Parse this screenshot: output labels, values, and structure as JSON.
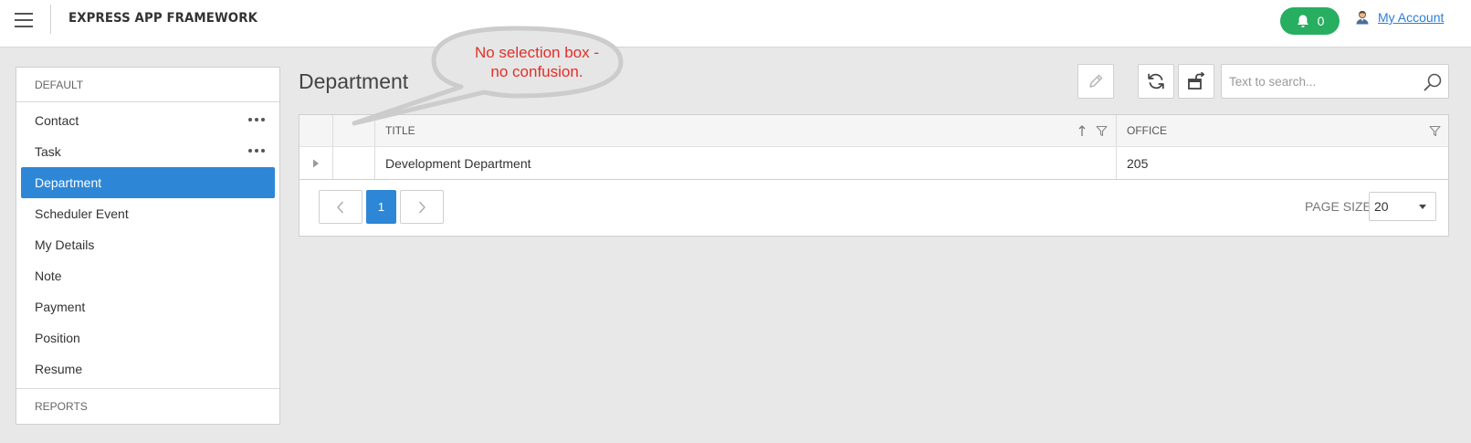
{
  "header": {
    "app_title": "EXPRESS APP FRAMEWORK",
    "notifications_count": "0",
    "account_label": "My Account"
  },
  "sidebar": {
    "group_default": "DEFAULT",
    "items": [
      {
        "label": "Contact",
        "has_menu": true
      },
      {
        "label": "Task",
        "has_menu": true
      },
      {
        "label": "Department",
        "active": true
      },
      {
        "label": "Scheduler Event"
      },
      {
        "label": "My Details"
      },
      {
        "label": "Note"
      },
      {
        "label": "Payment"
      },
      {
        "label": "Position"
      },
      {
        "label": "Resume"
      }
    ],
    "group_reports": "REPORTS"
  },
  "main": {
    "page_title": "Department",
    "search": {
      "placeholder": "Text to search..."
    }
  },
  "grid": {
    "columns": [
      "TITLE",
      "OFFICE"
    ],
    "rows": [
      {
        "title": "Development Department",
        "office": "205"
      }
    ]
  },
  "pager": {
    "current_page": "1",
    "page_size_label": "PAGE SIZE",
    "page_size": "20"
  },
  "callout": {
    "line1": "No selection box -",
    "line2": "no confusion."
  },
  "colors": {
    "accent": "#2d87d6",
    "notification": "#27ae60",
    "callout_text": "#e0302a"
  }
}
